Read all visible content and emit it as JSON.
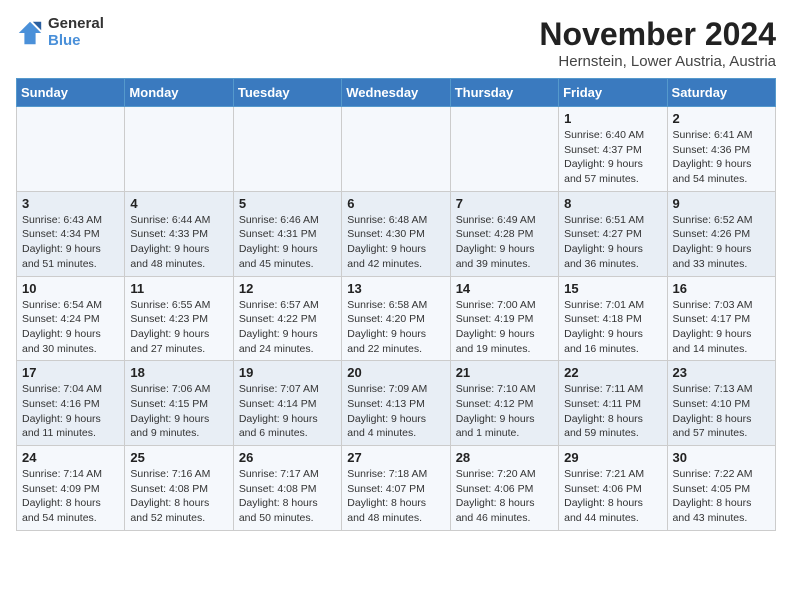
{
  "logo": {
    "general": "General",
    "blue": "Blue"
  },
  "title": "November 2024",
  "subtitle": "Hernstein, Lower Austria, Austria",
  "weekdays": [
    "Sunday",
    "Monday",
    "Tuesday",
    "Wednesday",
    "Thursday",
    "Friday",
    "Saturday"
  ],
  "weeks": [
    [
      {
        "day": "",
        "info": ""
      },
      {
        "day": "",
        "info": ""
      },
      {
        "day": "",
        "info": ""
      },
      {
        "day": "",
        "info": ""
      },
      {
        "day": "",
        "info": ""
      },
      {
        "day": "1",
        "info": "Sunrise: 6:40 AM\nSunset: 4:37 PM\nDaylight: 9 hours\nand 57 minutes."
      },
      {
        "day": "2",
        "info": "Sunrise: 6:41 AM\nSunset: 4:36 PM\nDaylight: 9 hours\nand 54 minutes."
      }
    ],
    [
      {
        "day": "3",
        "info": "Sunrise: 6:43 AM\nSunset: 4:34 PM\nDaylight: 9 hours\nand 51 minutes."
      },
      {
        "day": "4",
        "info": "Sunrise: 6:44 AM\nSunset: 4:33 PM\nDaylight: 9 hours\nand 48 minutes."
      },
      {
        "day": "5",
        "info": "Sunrise: 6:46 AM\nSunset: 4:31 PM\nDaylight: 9 hours\nand 45 minutes."
      },
      {
        "day": "6",
        "info": "Sunrise: 6:48 AM\nSunset: 4:30 PM\nDaylight: 9 hours\nand 42 minutes."
      },
      {
        "day": "7",
        "info": "Sunrise: 6:49 AM\nSunset: 4:28 PM\nDaylight: 9 hours\nand 39 minutes."
      },
      {
        "day": "8",
        "info": "Sunrise: 6:51 AM\nSunset: 4:27 PM\nDaylight: 9 hours\nand 36 minutes."
      },
      {
        "day": "9",
        "info": "Sunrise: 6:52 AM\nSunset: 4:26 PM\nDaylight: 9 hours\nand 33 minutes."
      }
    ],
    [
      {
        "day": "10",
        "info": "Sunrise: 6:54 AM\nSunset: 4:24 PM\nDaylight: 9 hours\nand 30 minutes."
      },
      {
        "day": "11",
        "info": "Sunrise: 6:55 AM\nSunset: 4:23 PM\nDaylight: 9 hours\nand 27 minutes."
      },
      {
        "day": "12",
        "info": "Sunrise: 6:57 AM\nSunset: 4:22 PM\nDaylight: 9 hours\nand 24 minutes."
      },
      {
        "day": "13",
        "info": "Sunrise: 6:58 AM\nSunset: 4:20 PM\nDaylight: 9 hours\nand 22 minutes."
      },
      {
        "day": "14",
        "info": "Sunrise: 7:00 AM\nSunset: 4:19 PM\nDaylight: 9 hours\nand 19 minutes."
      },
      {
        "day": "15",
        "info": "Sunrise: 7:01 AM\nSunset: 4:18 PM\nDaylight: 9 hours\nand 16 minutes."
      },
      {
        "day": "16",
        "info": "Sunrise: 7:03 AM\nSunset: 4:17 PM\nDaylight: 9 hours\nand 14 minutes."
      }
    ],
    [
      {
        "day": "17",
        "info": "Sunrise: 7:04 AM\nSunset: 4:16 PM\nDaylight: 9 hours\nand 11 minutes."
      },
      {
        "day": "18",
        "info": "Sunrise: 7:06 AM\nSunset: 4:15 PM\nDaylight: 9 hours\nand 9 minutes."
      },
      {
        "day": "19",
        "info": "Sunrise: 7:07 AM\nSunset: 4:14 PM\nDaylight: 9 hours\nand 6 minutes."
      },
      {
        "day": "20",
        "info": "Sunrise: 7:09 AM\nSunset: 4:13 PM\nDaylight: 9 hours\nand 4 minutes."
      },
      {
        "day": "21",
        "info": "Sunrise: 7:10 AM\nSunset: 4:12 PM\nDaylight: 9 hours\nand 1 minute."
      },
      {
        "day": "22",
        "info": "Sunrise: 7:11 AM\nSunset: 4:11 PM\nDaylight: 8 hours\nand 59 minutes."
      },
      {
        "day": "23",
        "info": "Sunrise: 7:13 AM\nSunset: 4:10 PM\nDaylight: 8 hours\nand 57 minutes."
      }
    ],
    [
      {
        "day": "24",
        "info": "Sunrise: 7:14 AM\nSunset: 4:09 PM\nDaylight: 8 hours\nand 54 minutes."
      },
      {
        "day": "25",
        "info": "Sunrise: 7:16 AM\nSunset: 4:08 PM\nDaylight: 8 hours\nand 52 minutes."
      },
      {
        "day": "26",
        "info": "Sunrise: 7:17 AM\nSunset: 4:08 PM\nDaylight: 8 hours\nand 50 minutes."
      },
      {
        "day": "27",
        "info": "Sunrise: 7:18 AM\nSunset: 4:07 PM\nDaylight: 8 hours\nand 48 minutes."
      },
      {
        "day": "28",
        "info": "Sunrise: 7:20 AM\nSunset: 4:06 PM\nDaylight: 8 hours\nand 46 minutes."
      },
      {
        "day": "29",
        "info": "Sunrise: 7:21 AM\nSunset: 4:06 PM\nDaylight: 8 hours\nand 44 minutes."
      },
      {
        "day": "30",
        "info": "Sunrise: 7:22 AM\nSunset: 4:05 PM\nDaylight: 8 hours\nand 43 minutes."
      }
    ]
  ]
}
